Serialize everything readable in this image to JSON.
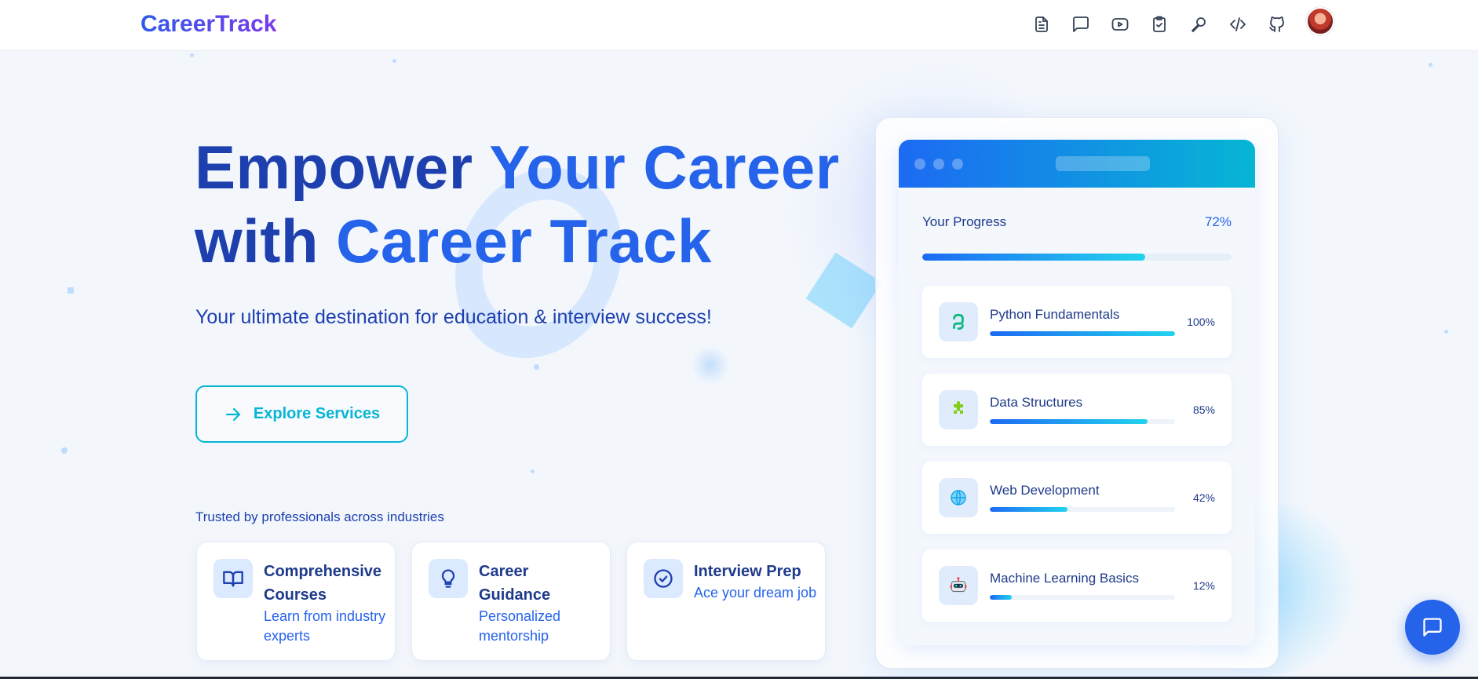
{
  "header": {
    "logo": "CareerTrack",
    "nav_icons": [
      "document-icon",
      "message-icon",
      "video-icon",
      "clipboard-check-icon",
      "microphone-icon",
      "code-icon",
      "github-icon"
    ]
  },
  "hero": {
    "title_line1_a": "Empower ",
    "title_line1_b": "Your Career",
    "title_line2_a": "with ",
    "title_line2_b": "Career Track",
    "subtitle": "Your ultimate destination for education & interview success!",
    "cta_label": "Explore Services",
    "trusted_text": "Trusted by professionals across industries"
  },
  "features": [
    {
      "title": "Comprehensive Courses",
      "desc": "Learn from industry experts",
      "icon": "book-icon"
    },
    {
      "title": "Career Guidance",
      "desc": "Personalized mentorship",
      "icon": "lightbulb-icon"
    },
    {
      "title": "Interview Prep",
      "desc": "Ace your dream job",
      "icon": "check-circle-icon"
    }
  ],
  "dashboard": {
    "progress_label": "Your Progress",
    "progress_pct": "72%",
    "progress_value": 0.72,
    "courses": [
      {
        "name": "Python Fundamentals",
        "pct": "100%",
        "value": 1.0,
        "icon": "python-icon"
      },
      {
        "name": "Data Structures",
        "pct": "85%",
        "value": 0.85,
        "icon": "puzzle-icon"
      },
      {
        "name": "Web Development",
        "pct": "42%",
        "value": 0.42,
        "icon": "globe-icon"
      },
      {
        "name": "Machine Learning Basics",
        "pct": "12%",
        "value": 0.12,
        "icon": "robot-icon"
      }
    ]
  },
  "colors": {
    "primary": "#1e40af",
    "accent": "#2563eb",
    "cyan": "#06b6d4"
  }
}
